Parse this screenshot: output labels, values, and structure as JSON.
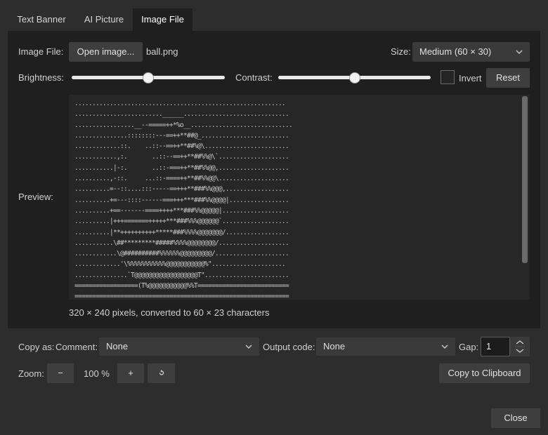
{
  "tabs": [
    {
      "label": "Text Banner",
      "active": false
    },
    {
      "label": "AI Picture",
      "active": false
    },
    {
      "label": "Image File",
      "active": true
    }
  ],
  "image_file": {
    "label": "Image File:",
    "open_button": "Open image...",
    "filename": "ball.png"
  },
  "size": {
    "label": "Size:",
    "value": "Medium (60 × 30)"
  },
  "brightness": {
    "label": "Brightness:",
    "value": 0.5
  },
  "contrast": {
    "label": "Contrast:",
    "value": 0.5
  },
  "invert": {
    "label": "Invert",
    "checked": false
  },
  "reset_button": "Reset",
  "preview": {
    "label": "Preview:",
    "ascii": "............................................................\n.........................______..............................\n.................__--=====++*%o__.............................\n...............::::::::---==++**##@_.........................\n.............::.    ..::--==++**##%@\\........................\n............,:.       ..::--==++**##%%@\\`....................\n...........|-:.       ..::-===++**##%%@@,....................\n..........,-::.     ...::-====++**##%%@@\\....................\n..........=--::....:::-----==+++**###%%@@@,..................\n..........+=---::::------===+++***###%%@@@@|.................\n..........+==-------====++++***###%%@@@@@|...................\n..........|+++=======+++++***###%%%@@@@@@`...................\n..........|**++++++++++*****###%%%%@@@@@@@/..................\n...........\\##*********#####%%%%@@@@@@@@/....................\n............\\@##########%%%%%%@@@@@@@@@/.....................\n.............'\\%%%%%%%%%%%@@@@@@@@@@@%\".....................\n...............`T@@@@@@@@@@@@@@@@@@T\"........................\n==================(T%@@@@@@@@@@@%%T==========================\n============================================================="
  },
  "info": "320 × 240 pixels, converted to 60 × 23 characters",
  "copy_as": {
    "label": "Copy as:",
    "comment_label": "Comment:",
    "comment_value": "None",
    "output_label": "Output code:",
    "output_value": "None",
    "gap_label": "Gap:",
    "gap_value": "1"
  },
  "zoom": {
    "label": "Zoom:",
    "minus": "−",
    "value": "100 %",
    "plus": "+"
  },
  "copy_button": "Copy to Clipboard",
  "close_button": "Close",
  "colors": {
    "background": "#2d2d2d",
    "panel": "#1f1f1f",
    "button": "#3e3e3e"
  }
}
